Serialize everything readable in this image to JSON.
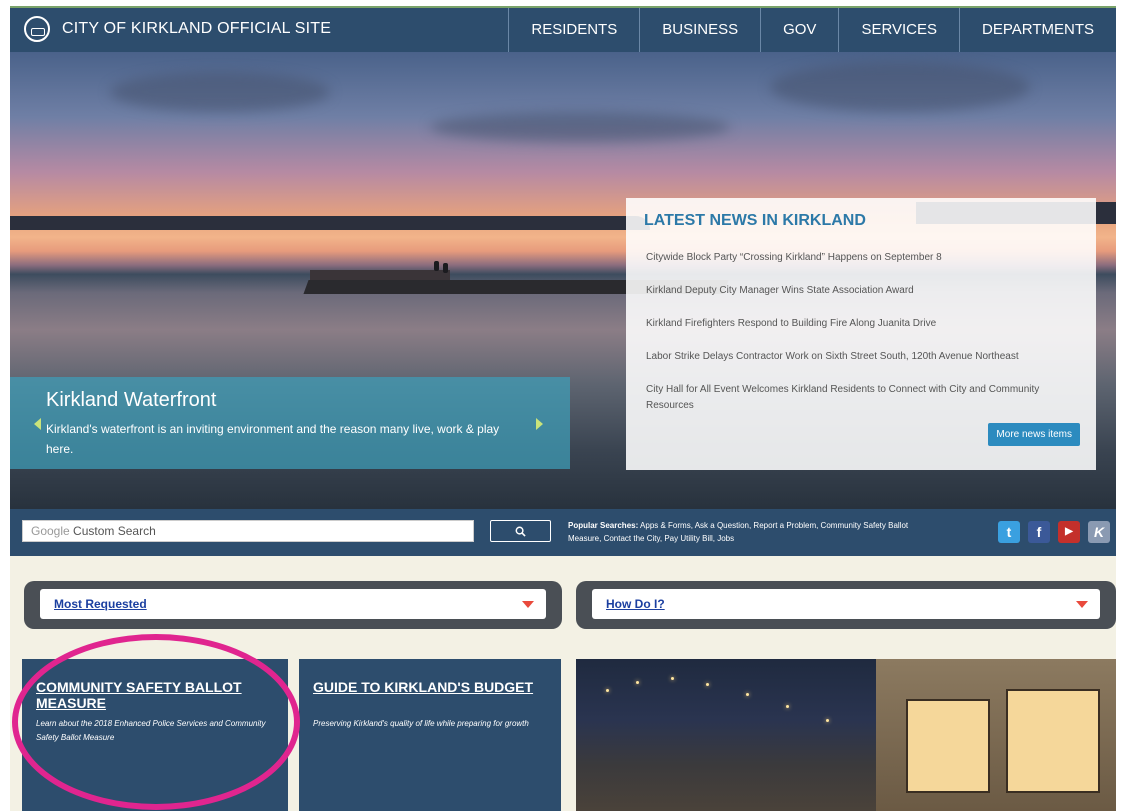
{
  "header": {
    "site_title": "CITY OF KIRKLAND OFFICIAL SITE",
    "nav": [
      "RESIDENTS",
      "BUSINESS",
      "GOV",
      "SERVICES",
      "DEPARTMENTS"
    ]
  },
  "hero": {
    "caption_title": "Kirkland Waterfront",
    "caption_desc": "Kirkland's waterfront is an inviting environment and the reason many live, work & play here."
  },
  "news": {
    "title": "LATEST NEWS IN KIRKLAND",
    "items": [
      "Citywide Block Party “Crossing Kirkland” Happens on September 8",
      "Kirkland Deputy City Manager Wins State Association Award",
      "Kirkland Firefighters Respond to Building Fire Along Juanita Drive",
      "Labor Strike Delays Contractor Work on Sixth Street South, 120th Avenue Northeast",
      "City Hall for All Event Welcomes Kirkland Residents to Connect with City and Community Resources"
    ],
    "more_button": "More news items"
  },
  "search": {
    "brand": "Google",
    "placeholder": "Custom Search",
    "button_icon": "search-icon",
    "popular_label": "Popular Searches:",
    "popular_links": "Apps & Forms, Ask a Question, Report a Problem, Community Safety Ballot Measure, Contact the City, Pay Utility Bill, Jobs"
  },
  "social": [
    {
      "name": "twitter-icon",
      "glyph": "t",
      "color": "#3aa0e0"
    },
    {
      "name": "facebook-icon",
      "glyph": "f",
      "color": "#3b5998"
    },
    {
      "name": "youtube-icon",
      "glyph": "▶",
      "color": "#c4302b"
    },
    {
      "name": "kirkland-icon",
      "glyph": "K",
      "color": "#8a9ab2"
    }
  ],
  "dropdowns": {
    "most_requested": "Most Requested",
    "how_do_i": "How Do I?"
  },
  "tiles": [
    {
      "title": "COMMUNITY SAFETY BALLOT MEASURE",
      "desc": "Learn about the 2018 Enhanced Police Services and Community Safety Ballot Measure"
    },
    {
      "title": "GUIDE TO KIRKLAND'S BUDGET",
      "desc": "Preserving Kirkland's quality of life while preparing for growth"
    }
  ],
  "colors": {
    "navy": "#2d4d6d",
    "highlight_circle": "#e0258f",
    "news_title": "#2c79a8"
  }
}
